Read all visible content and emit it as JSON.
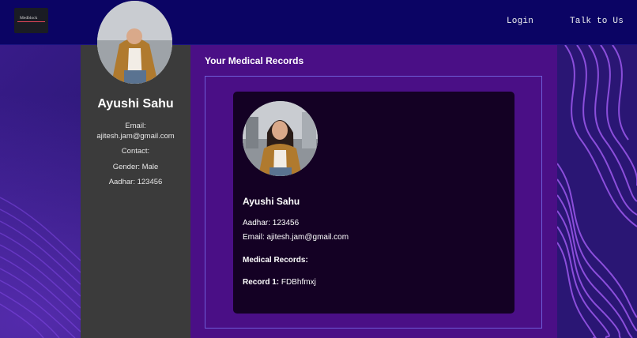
{
  "navbar": {
    "logo_text": "Medblock",
    "links": [
      "Login",
      "Talk to Us"
    ]
  },
  "profile": {
    "name": "Ayushi Sahu",
    "email_label": "Email:",
    "email": "ajitesh.jam@gmail.com",
    "contact_label": "Contact:",
    "gender": "Gender: Male",
    "aadhar": "Aadhar: 123456"
  },
  "records": {
    "title": "Your Medical Records",
    "card": {
      "name": "Ayushi Sahu",
      "aadhar": "Aadhar: 123456",
      "email": "Email: ajitesh.jam@gmail.com",
      "medical_records_label": "Medical Records:",
      "record_label": "Record 1:",
      "record_value": "FDBhfmxj"
    }
  },
  "colors": {
    "navbar": "#0b0464",
    "sidebar": "#3b3b3b",
    "main_panel": "#4a0f86",
    "card": "#140124",
    "box_border": "#6d5cd6"
  },
  "icons": [
    "logo-icon",
    "profile-photo"
  ]
}
